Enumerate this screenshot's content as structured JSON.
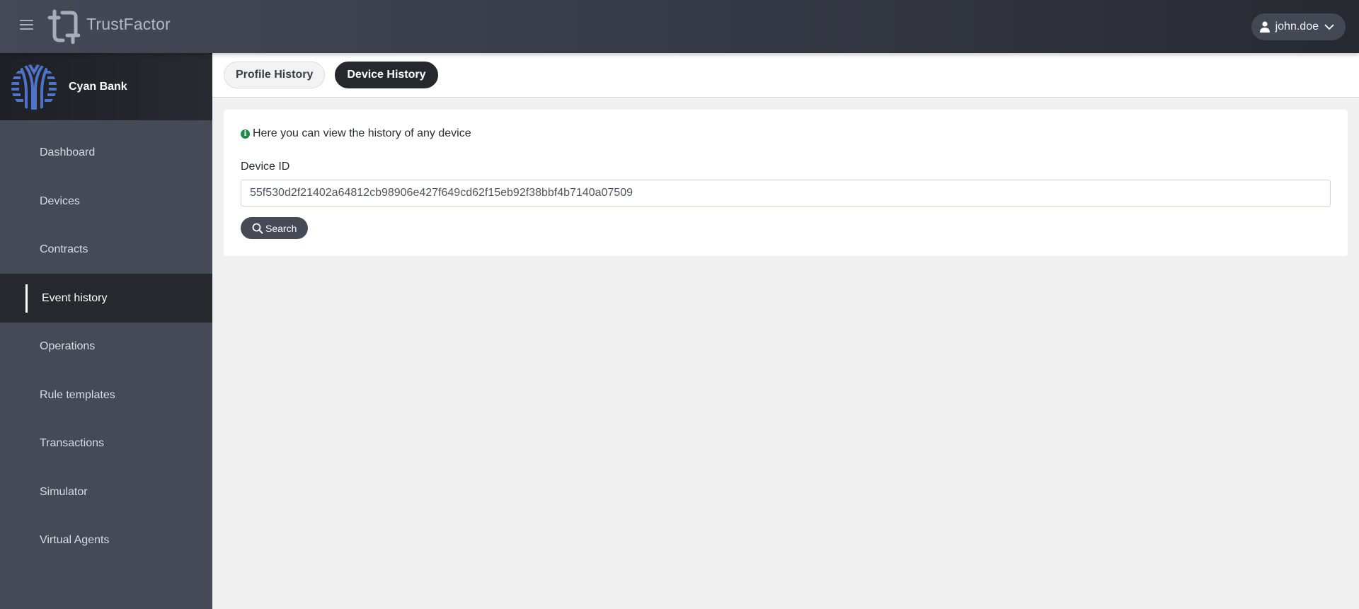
{
  "header": {
    "app_name": "TrustFactor",
    "user": {
      "name": "john.doe"
    }
  },
  "sidebar": {
    "brand_name": "Cyan Bank",
    "brand_color": "#4f73c6",
    "active_item": "Event history",
    "items": [
      {
        "label": "Dashboard"
      },
      {
        "label": "Devices"
      },
      {
        "label": "Contracts"
      },
      {
        "label": "Event history"
      },
      {
        "label": "Operations"
      },
      {
        "label": "Rule templates"
      },
      {
        "label": "Transactions"
      },
      {
        "label": "Simulator"
      },
      {
        "label": "Virtual Agents"
      }
    ]
  },
  "tabs": [
    {
      "label": "Profile History",
      "active": false
    },
    {
      "label": "Device History",
      "active": true
    }
  ],
  "main": {
    "info_text": "Here you can view the history of any device",
    "info_icon": "info-circle-icon",
    "info_color": "#1f8a4c",
    "device_id_label": "Device ID",
    "device_id_value": "55f530d2f21402a64812cb98906e427f649cd62f15eb92f38bbf4b7140a07509",
    "search_label": "Search"
  }
}
